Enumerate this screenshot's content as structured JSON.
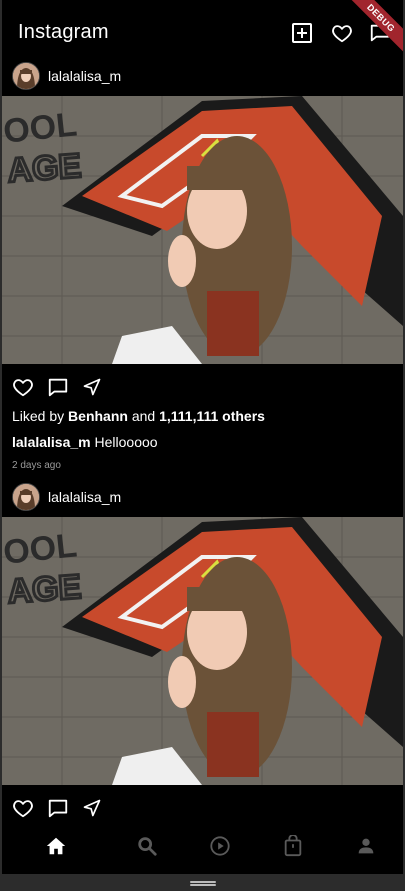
{
  "app": {
    "title": "Instagram",
    "debug_label": "DEBUG"
  },
  "posts": [
    {
      "username": "lalalalisa_m",
      "liked_by": "Benhann",
      "liked_and": "and",
      "liked_prefix": "Liked by",
      "others": "1,111,111 others",
      "caption_user": "lalalalisa_m",
      "caption_text": "Hellooooo",
      "time": "2 days ago"
    },
    {
      "username": "lalalalisa_m"
    }
  ],
  "icons": {
    "add": "add-box-icon",
    "heart": "heart-outline-icon",
    "messenger": "send-icon",
    "comment": "comment-icon",
    "share": "share-icon",
    "home": "home-icon",
    "search": "search-icon",
    "reels": "play-circle-icon",
    "shop": "shopping-bag-icon",
    "profile": "person-icon"
  },
  "colors": {
    "background": "#000000",
    "nav_inactive": "#5a5a5a",
    "nav_active": "#ffffff",
    "debug_ribbon": "#a1252d"
  }
}
